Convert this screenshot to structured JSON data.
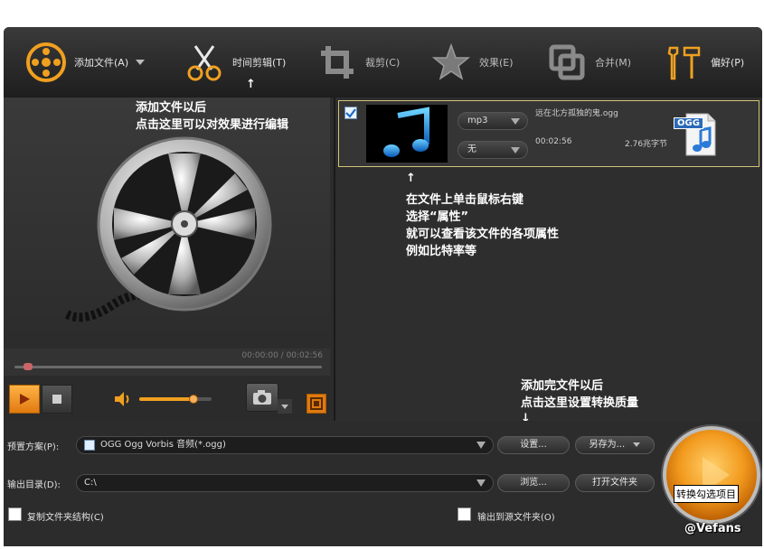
{
  "toolbar": {
    "add_file": "添加文件(A)",
    "time_clip": "时间剪辑(T)",
    "crop": "裁剪(C)",
    "effects": "效果(E)",
    "merge": "合并(M)",
    "preferences": "偏好(P)"
  },
  "preview": {
    "time": "00:00:00 / 00:02:56",
    "progress": 0.03,
    "volume": 0.75
  },
  "file": {
    "name": "远在北方孤独的鬼.ogg",
    "format": "mp3",
    "subtitle": "无",
    "duration": "00:02:56",
    "size": "2.76兆字节",
    "type_badge": "OGG",
    "checked": true
  },
  "annotations": {
    "effects_hint": [
      "添加文件以后",
      "点击这里可以对效果进行编辑"
    ],
    "properties_hint": [
      "在文件上单击鼠标右键",
      "选择“属性”",
      "就可以查看该文件的各项属性",
      "例如比特率等"
    ],
    "settings_hint": [
      "添加完文件以后",
      "点击这里设置转换质量"
    ],
    "arrow_up": "↑",
    "arrow_down": "↓"
  },
  "bottom": {
    "preset_label": "预置方案(P):",
    "preset_value": "OGG Ogg Vorbis 音频(*.ogg)",
    "settings_btn": "设置...",
    "save_as_btn": "另存为...",
    "output_label": "输出目录(D):",
    "output_value": "C:\\",
    "browse_btn": "浏览...",
    "open_folder_btn": "打开文件夹",
    "copy_structure": "复制文件夹结构(C)",
    "output_to_source": "输出到源文件夹(O)",
    "convert_btn": "转换勾选项目"
  },
  "watermark": "@Vefans",
  "colors": {
    "accent_orange": "#f29a1e",
    "dark_bg": "#2c2c2c",
    "selection_border": "#d4c27a"
  }
}
